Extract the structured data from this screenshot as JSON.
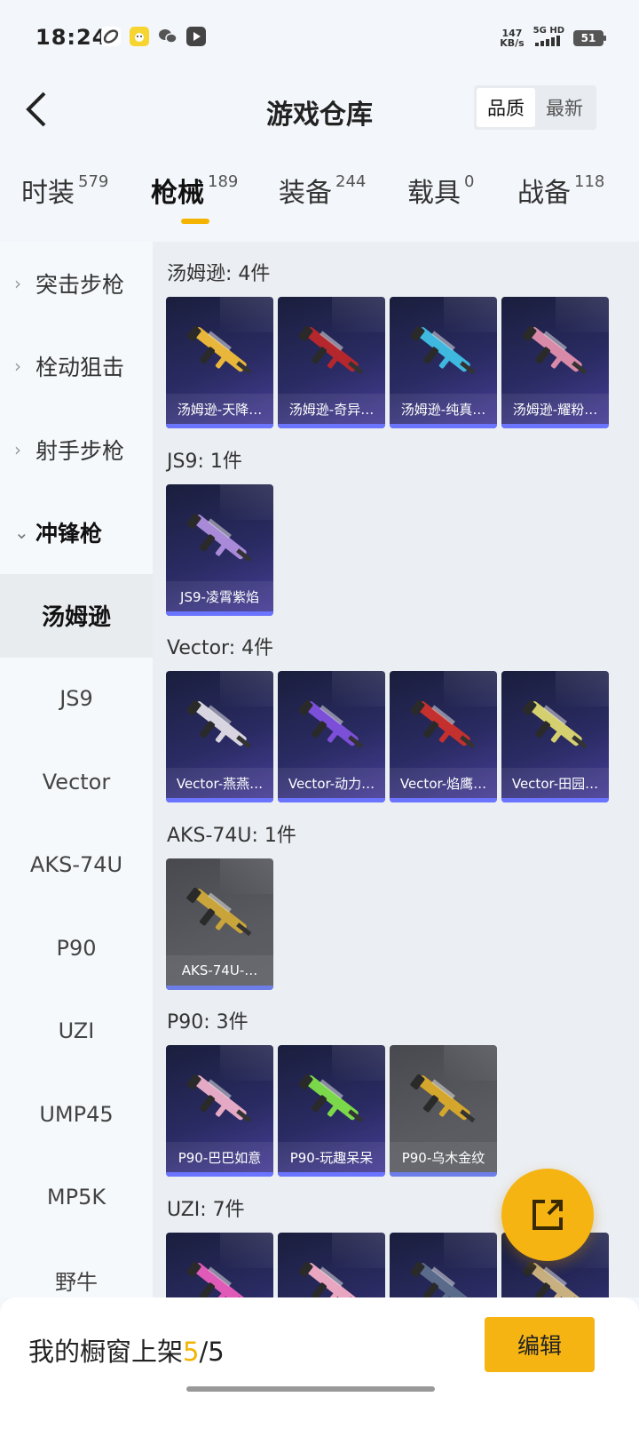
{
  "status_bar": {
    "time": "18:24",
    "speed_value": "147",
    "speed_unit": "KB/s",
    "network": "5G HD",
    "battery": "51"
  },
  "header": {
    "title": "游戏仓库",
    "sort_options": [
      "品质",
      "最新"
    ],
    "active_sort": "品质"
  },
  "tabs": [
    {
      "label": "时装",
      "count": "579"
    },
    {
      "label": "枪械",
      "count": "189"
    },
    {
      "label": "装备",
      "count": "244"
    },
    {
      "label": "载具",
      "count": "0"
    },
    {
      "label": "战备",
      "count": "118"
    }
  ],
  "active_tab": "枪械",
  "sidebar": {
    "groups": [
      {
        "label": "突击步枪"
      },
      {
        "label": "栓动狙击"
      },
      {
        "label": "射手步枪"
      },
      {
        "label": "冲锋枪"
      }
    ],
    "sub_items": [
      {
        "label": "汤姆逊"
      },
      {
        "label": "JS9"
      },
      {
        "label": "Vector"
      },
      {
        "label": "AKS-74U"
      },
      {
        "label": "P90"
      },
      {
        "label": "UZI"
      },
      {
        "label": "UMP45"
      },
      {
        "label": "MP5K"
      },
      {
        "label": "野牛"
      }
    ],
    "active_sub": "汤姆逊"
  },
  "sections": [
    {
      "title": "汤姆逊: 4件",
      "items": [
        {
          "name": "汤姆逊-天降…",
          "rarity": "epic",
          "color": "#e8b63a"
        },
        {
          "name": "汤姆逊-奇异…",
          "rarity": "epic",
          "color": "#b3272d"
        },
        {
          "name": "汤姆逊-纯真…",
          "rarity": "epic",
          "color": "#3fb8e0"
        },
        {
          "name": "汤姆逊-耀粉…",
          "rarity": "epic",
          "color": "#d98aa8"
        }
      ]
    },
    {
      "title": "JS9: 1件",
      "items": [
        {
          "name": "JS9-凌霄紫焰",
          "rarity": "epic",
          "color": "#a88ad8"
        }
      ]
    },
    {
      "title": "Vector: 4件",
      "items": [
        {
          "name": "Vector-燕燕…",
          "rarity": "epic",
          "color": "#d8d4e0"
        },
        {
          "name": "Vector-动力…",
          "rarity": "epic",
          "color": "#7b4fd8"
        },
        {
          "name": "Vector-焰鹰…",
          "rarity": "epic",
          "color": "#c4302e"
        },
        {
          "name": "Vector-田园…",
          "rarity": "epic",
          "color": "#d4d070"
        }
      ]
    },
    {
      "title": "AKS-74U: 1件",
      "items": [
        {
          "name": "AKS-74U-…",
          "rarity": "rare",
          "color": "#c9a43a"
        }
      ]
    },
    {
      "title": "P90: 3件",
      "items": [
        {
          "name": "P90-巴巴如意",
          "rarity": "epic",
          "color": "#e4a9c4"
        },
        {
          "name": "P90-玩趣呆呆",
          "rarity": "epic",
          "color": "#7bd84a"
        },
        {
          "name": "P90-乌木金纹",
          "rarity": "rare",
          "color": "#d4a72c"
        }
      ]
    },
    {
      "title": "UZI: 7件",
      "items": [
        {
          "name": "",
          "rarity": "epic",
          "color": "#e05ab8"
        },
        {
          "name": "",
          "rarity": "epic",
          "color": "#e8a6c0"
        },
        {
          "name": "",
          "rarity": "epic",
          "color": "#5a6a8a"
        },
        {
          "name": "",
          "rarity": "epic",
          "color": "#c8b080"
        }
      ]
    }
  ],
  "bottom_bar": {
    "shelf_label": "我的橱窗上架",
    "shelf_current": "5",
    "shelf_sep": "/",
    "shelf_total": "5",
    "edit_label": "编辑"
  },
  "icons": {
    "back": "chevron-left-icon",
    "fab": "share-external-icon"
  }
}
